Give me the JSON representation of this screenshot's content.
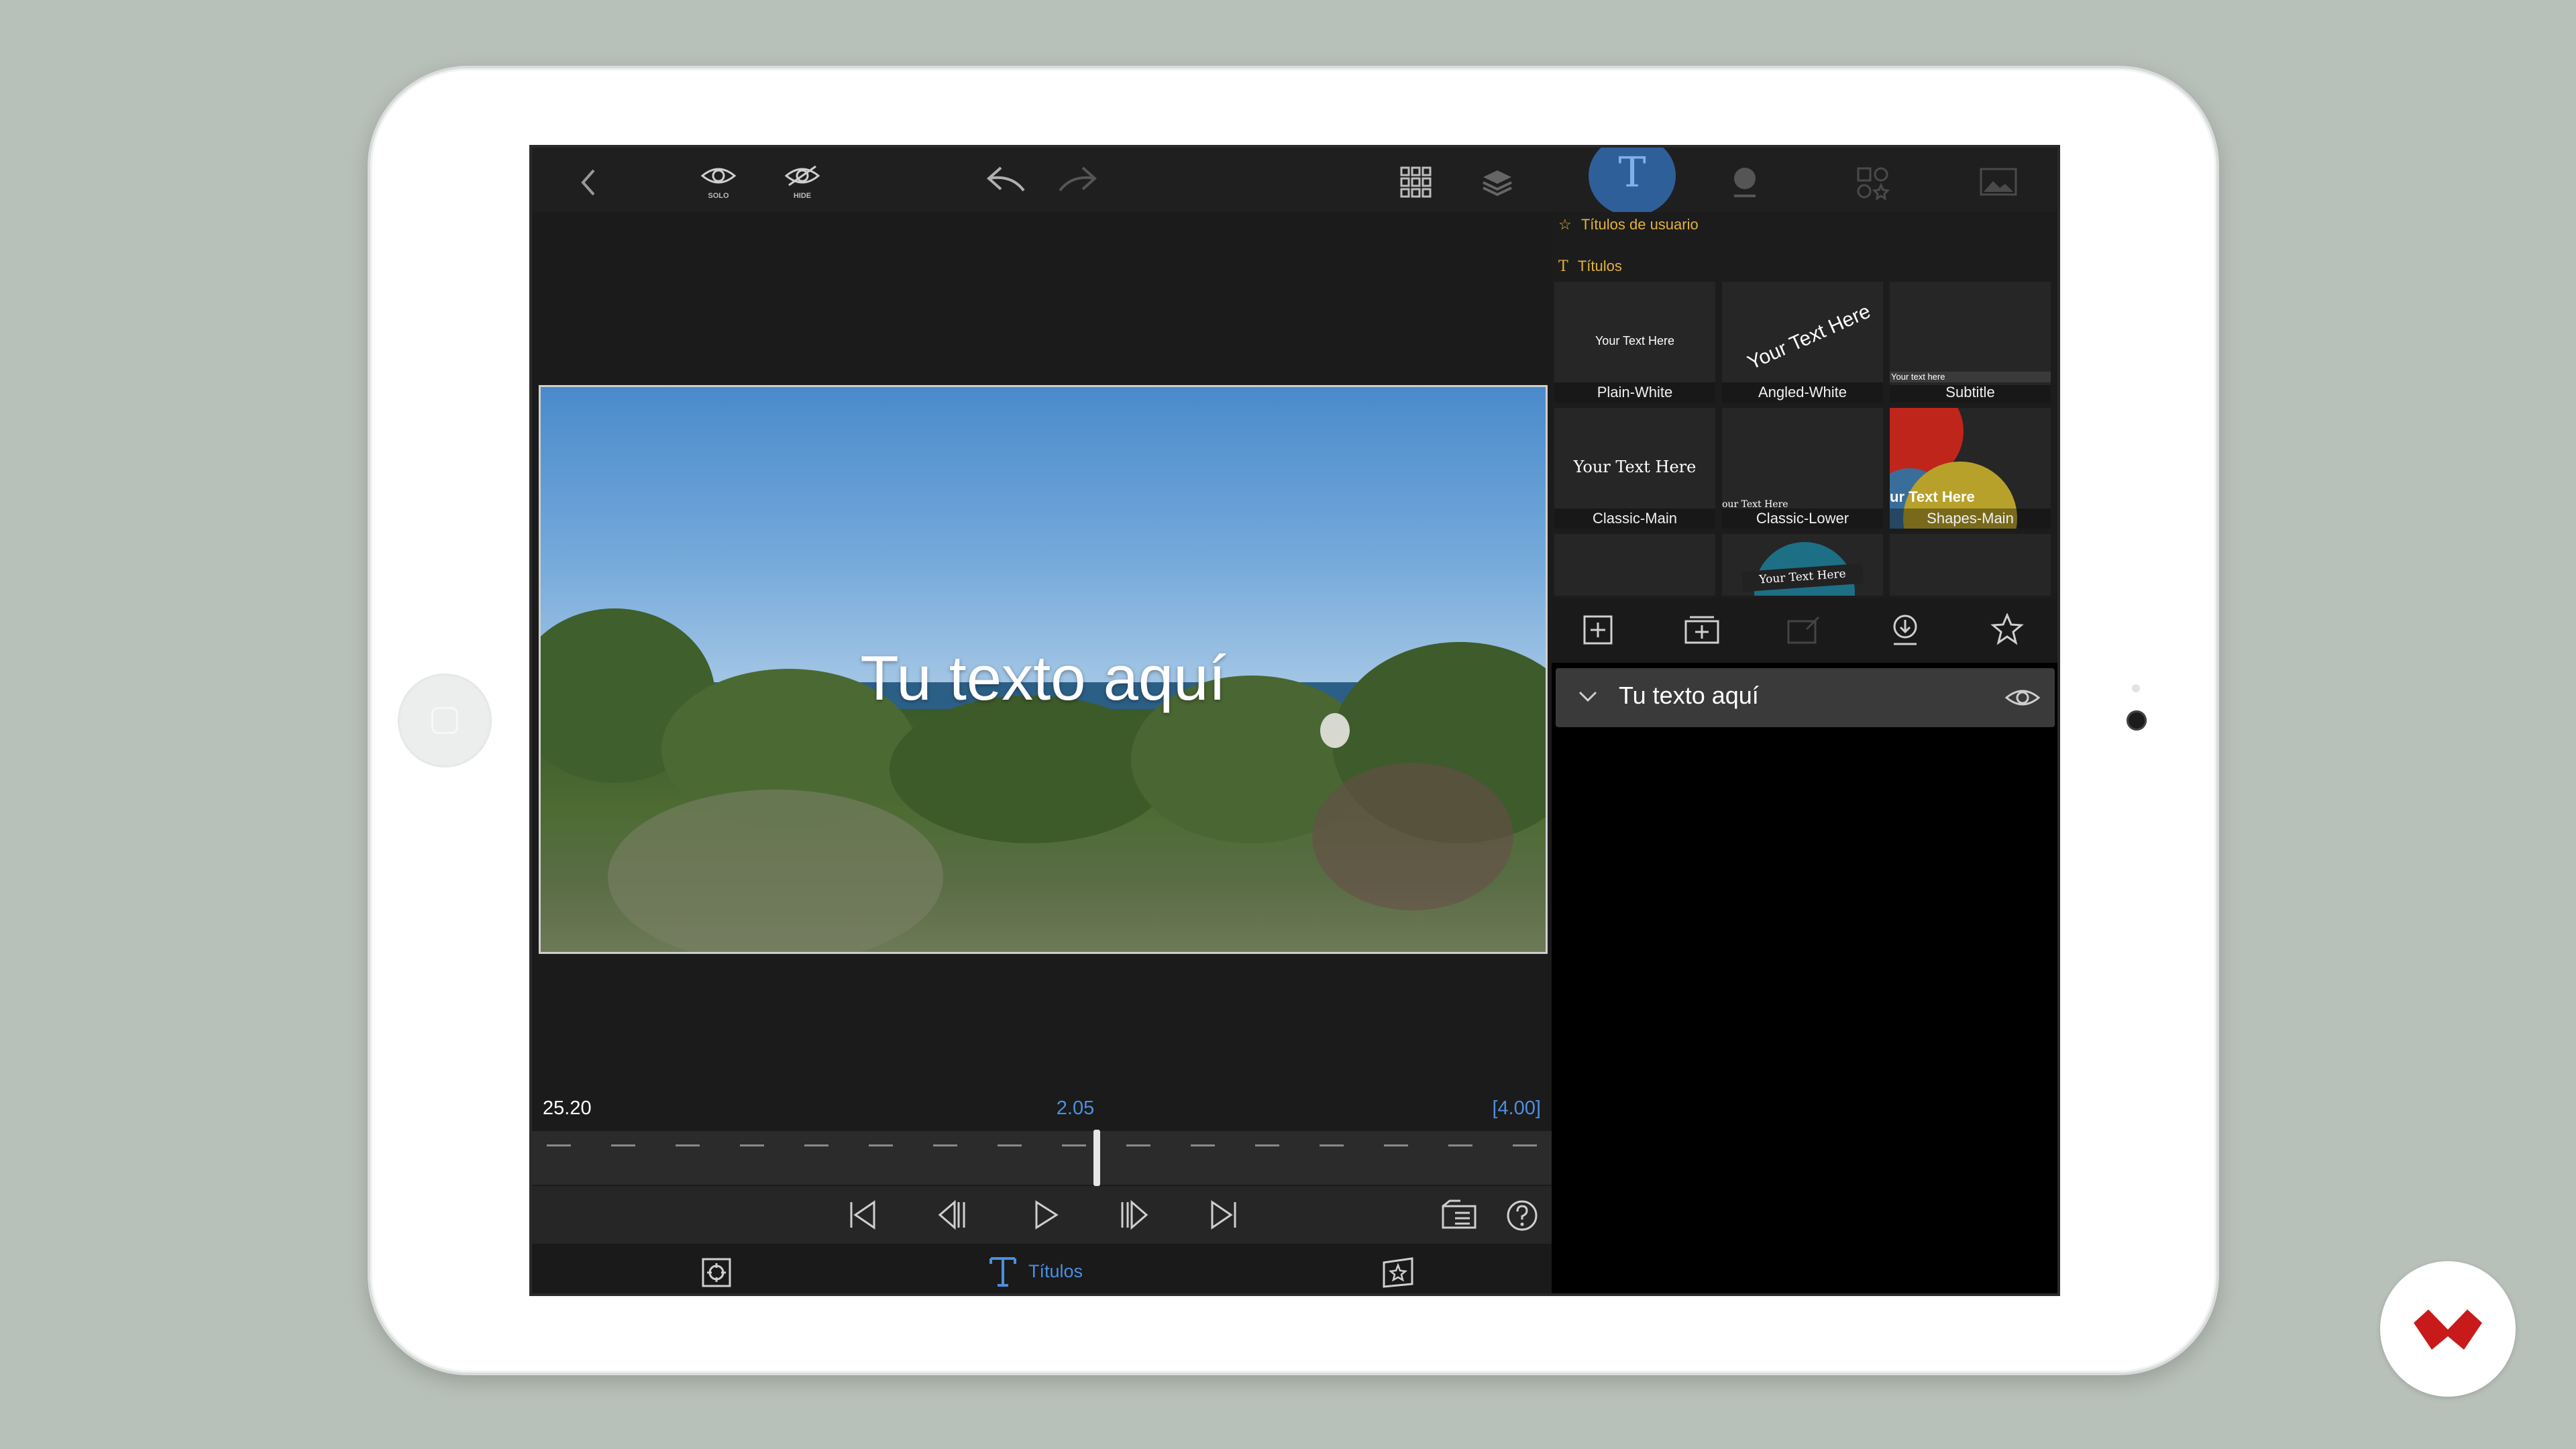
{
  "topbar": {
    "solo_label": "SOLO",
    "hide_label": "HIDE",
    "icons": [
      "back-icon",
      "solo-eye-icon",
      "hide-eye-icon",
      "undo-icon",
      "redo-icon",
      "grid-icon",
      "layers-icon",
      "titles-icon",
      "globe-icon",
      "shapes-icon",
      "image-icon"
    ],
    "active_tab": "T"
  },
  "preview": {
    "overlay_text": "Tu texto aquí"
  },
  "timeline": {
    "left_time": "25.20",
    "current_time": "2.05",
    "duration": "[4.00]"
  },
  "bottom": {
    "titles_label": "Títulos"
  },
  "panel": {
    "section_user": "Títulos de usuario",
    "section_titles": "Títulos",
    "tiles": [
      {
        "name": "Plain-White",
        "sample": "Your Text Here"
      },
      {
        "name": "Angled-White",
        "sample": "Your Text Here"
      },
      {
        "name": "Subtitle",
        "sample": "Your text here"
      },
      {
        "name": "Classic-Main",
        "sample": "Your Text Here"
      },
      {
        "name": "Classic-Lower",
        "sample": "our Text Here"
      },
      {
        "name": "Shapes-Main",
        "sample": "ur Text Here"
      }
    ],
    "partial_tile_sample": "Your Text Here",
    "layer_label": "Tu texto aquí"
  },
  "colors": {
    "accent": "#4a90e2",
    "section_header": "#e3b23c",
    "active_tab_bg": "#2e5f99"
  }
}
